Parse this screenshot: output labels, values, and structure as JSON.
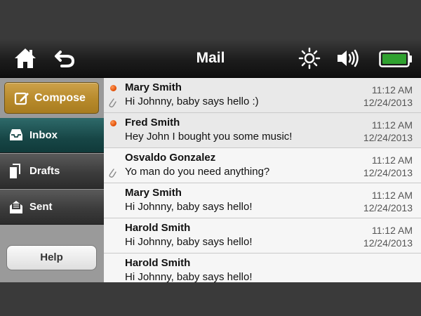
{
  "header": {
    "title": "Mail"
  },
  "icons": {
    "home": "home-icon",
    "back": "back-arrow-icon",
    "brightness": "brightness-icon",
    "volume": "speaker-icon",
    "battery": "battery-icon"
  },
  "colors": {
    "compose": "#b78a2b",
    "inbox_selected": "#174646",
    "unread_dot": "#e04a00",
    "battery": "#2fa12f"
  },
  "sidebar": {
    "compose": "Compose",
    "items": [
      {
        "label": "Inbox",
        "selected": true
      },
      {
        "label": "Drafts",
        "selected": false
      },
      {
        "label": "Sent",
        "selected": false
      }
    ],
    "help": "Help"
  },
  "messages": [
    {
      "sender": "Mary Smith",
      "preview": "Hi Johnny, baby says hello :)",
      "time": "11:12 AM",
      "date": "12/24/2013",
      "unread": true,
      "attachment": true
    },
    {
      "sender": "Fred Smith",
      "preview": "Hey John I bought you some music!",
      "time": "11:12 AM",
      "date": "12/24/2013",
      "unread": true,
      "attachment": false
    },
    {
      "sender": "Osvaldo Gonzalez",
      "preview": "Yo man do you need anything?",
      "time": "11:12 AM",
      "date": "12/24/2013",
      "unread": false,
      "attachment": true
    },
    {
      "sender": "Mary Smith",
      "preview": "Hi Johnny, baby says hello!",
      "time": "11:12 AM",
      "date": "12/24/2013",
      "unread": false,
      "attachment": false
    },
    {
      "sender": "Harold Smith",
      "preview": "Hi Johnny, baby says hello!",
      "time": "11:12 AM",
      "date": "12/24/2013",
      "unread": false,
      "attachment": false
    },
    {
      "sender": "Harold Smith",
      "preview": "Hi Johnny, baby says hello!",
      "time": "",
      "date": "",
      "unread": false,
      "attachment": false
    }
  ]
}
